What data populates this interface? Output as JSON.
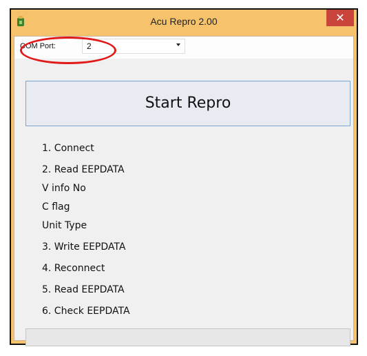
{
  "window": {
    "title": "Acu Repro 2.00",
    "close_label": "✕"
  },
  "com_port": {
    "label": "COM Port:",
    "value": "2"
  },
  "start_button": {
    "label": "Start Repro"
  },
  "steps": [
    "1. Connect",
    "2. Read EEPDATA",
    "V info No",
    "C flag",
    "Unit Type",
    "3. Write EEPDATA",
    "4. Reconnect",
    "5. Read EEPDATA",
    "6. Check EEPDATA"
  ],
  "progress": {
    "fraction": 0
  },
  "colors": {
    "title_bar": "#f6c36c",
    "close_button": "#c9453c",
    "highlight": "#e11818"
  }
}
